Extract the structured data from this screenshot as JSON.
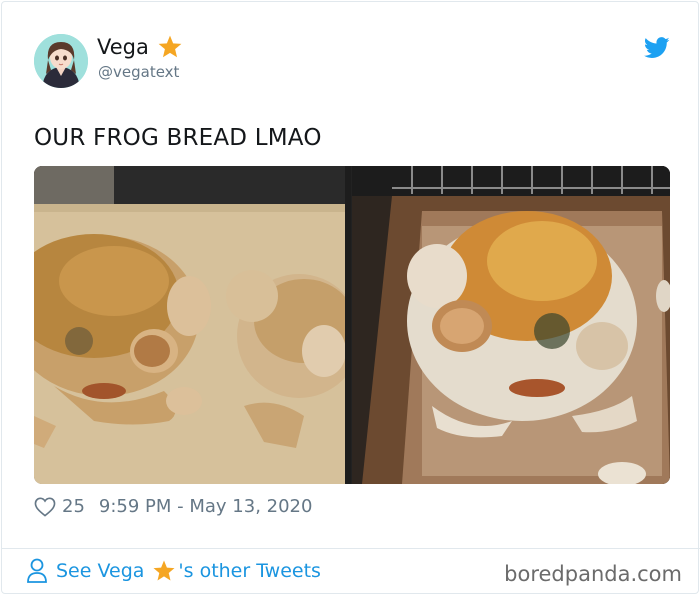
{
  "tweet": {
    "display_name": "Vega",
    "handle": "@vegatext",
    "text": "OUR FROG BREAD LMAO",
    "like_count": "25",
    "timestamp": "9:59 PM - May 13, 2020"
  },
  "footer": {
    "see_prefix": "See Vega",
    "see_suffix": "'s other Tweets",
    "watermark": "boredpanda.com"
  },
  "icons": {
    "star": "star-icon",
    "bird": "twitter-bird-icon",
    "heart": "heart-icon",
    "person": "person-icon"
  },
  "colors": {
    "accent": "#1b95e0",
    "twitter_blue": "#1da1f2",
    "star": "#f5a623",
    "secondary_text": "#657786"
  }
}
